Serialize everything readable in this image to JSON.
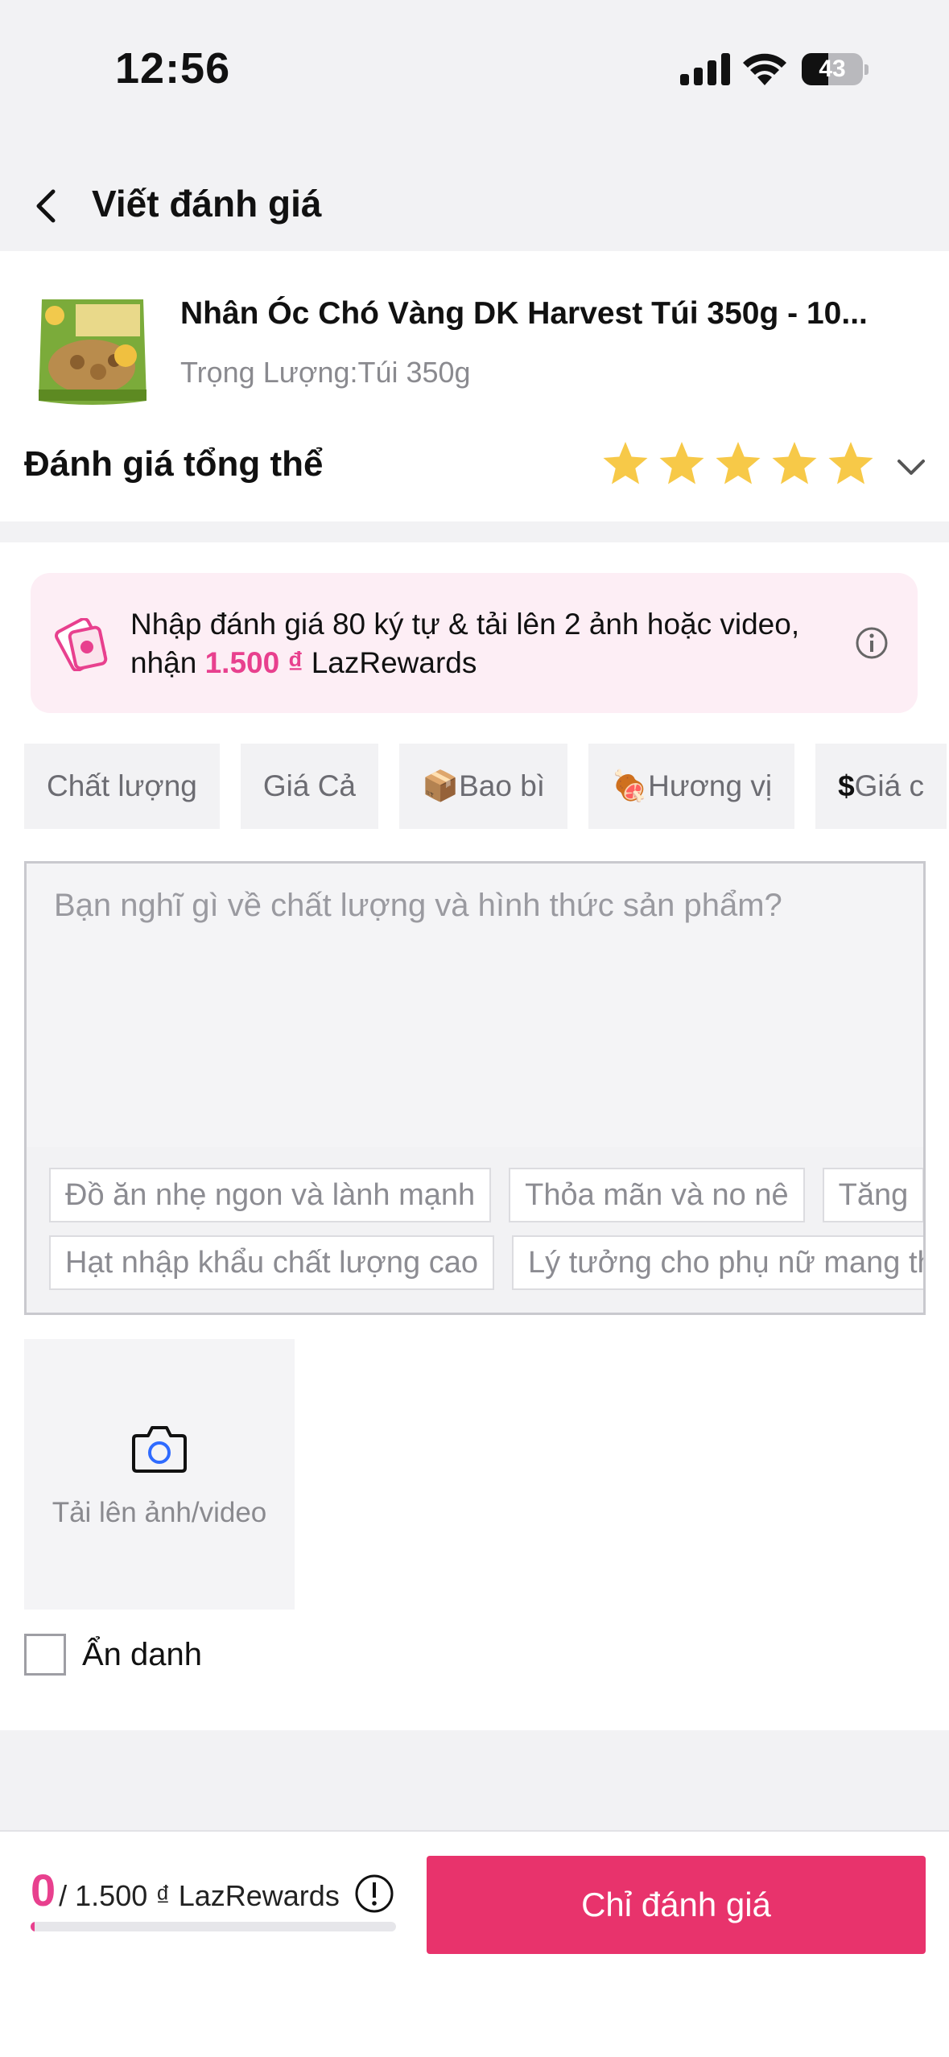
{
  "status_bar": {
    "time": "12:56",
    "battery_level": "43",
    "battery_fraction": 0.43
  },
  "header": {
    "title": "Viết đánh giá"
  },
  "product": {
    "name": "Nhân Óc Chó Vàng DK Harvest Túi 350g - 10...",
    "variant": "Trọng Lượng:Túi 350g"
  },
  "rating": {
    "label": "Đánh giá tổng thể",
    "stars": 5,
    "max_stars": 5,
    "star_color": "#f7c948"
  },
  "promo": {
    "text_before": "Nhập đánh giá 80 ký tự & tải lên 2 ảnh hoặc video, nhận ",
    "amount": "1.500 ₫",
    "text_after": " LazRewards",
    "accent_color": "#e8408e"
  },
  "tags": [
    {
      "label": "Chất lượng",
      "icon": ""
    },
    {
      "label": "Giá Cả",
      "icon": ""
    },
    {
      "label": "Bao bì",
      "icon": "📦"
    },
    {
      "label": "Hương vị",
      "icon": "🍖"
    },
    {
      "label": "Giá c",
      "icon": "$"
    }
  ],
  "review_input": {
    "placeholder": "Bạn nghĩ gì về chất lượng và hình thức sản phẩm?",
    "suggestions_row1": [
      "Đồ ăn nhẹ ngon và lành mạnh",
      "Thỏa mãn và no nê",
      "Tăng"
    ],
    "suggestions_row2": [
      "Hạt nhập khẩu chất lượng cao",
      "Lý tưởng cho phụ nữ mang thai"
    ]
  },
  "upload": {
    "label": "Tải lên ảnh/video"
  },
  "anonymous": {
    "label": "Ẩn danh",
    "checked": false
  },
  "footer": {
    "current": "0",
    "total": "/ 1.500 ₫  LazRewards",
    "progress": 0.01,
    "submit_label": "Chỉ đánh giá",
    "button_color": "#e8336c"
  }
}
